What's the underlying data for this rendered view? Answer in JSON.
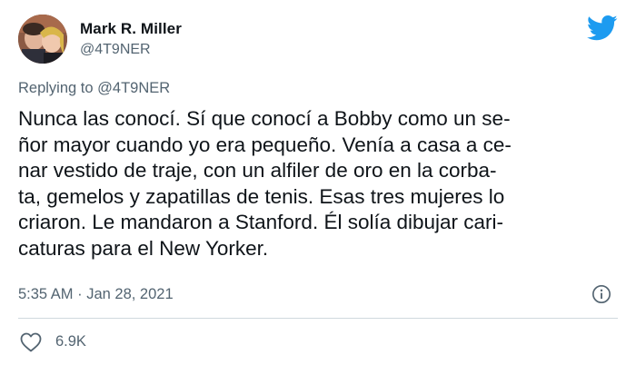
{
  "author": {
    "display_name": "Mark R. Miller",
    "handle": "@4T9NER"
  },
  "reply": {
    "prefix": "Replying to ",
    "mention": "@4T9NER"
  },
  "tweet": {
    "lines": [
      "Nunca las conocí. Sí que conocí a Bobby como un se-",
      "ñor mayor cuando yo era pequeño. Venía a casa a ce-",
      "nar vestido de traje, con un alfiler de oro en la corba-",
      "ta, gemelos y zapatillas de tenis. Esas tres mujeres lo",
      "criaron. Le mandaron a Stanford. Él solía dibujar cari-",
      "caturas para el New Yorker."
    ],
    "timestamp": "5:35 AM · Jan 28, 2021"
  },
  "stats": {
    "likes": "6.9K"
  },
  "icons": {
    "brand": "twitter-bird-icon",
    "info": "info-icon",
    "like": "heart-icon"
  },
  "colors": {
    "brand_blue": "#1d9bf0",
    "secondary_text": "#536471",
    "primary_text": "#0f1419",
    "divider": "#cfd9de"
  }
}
